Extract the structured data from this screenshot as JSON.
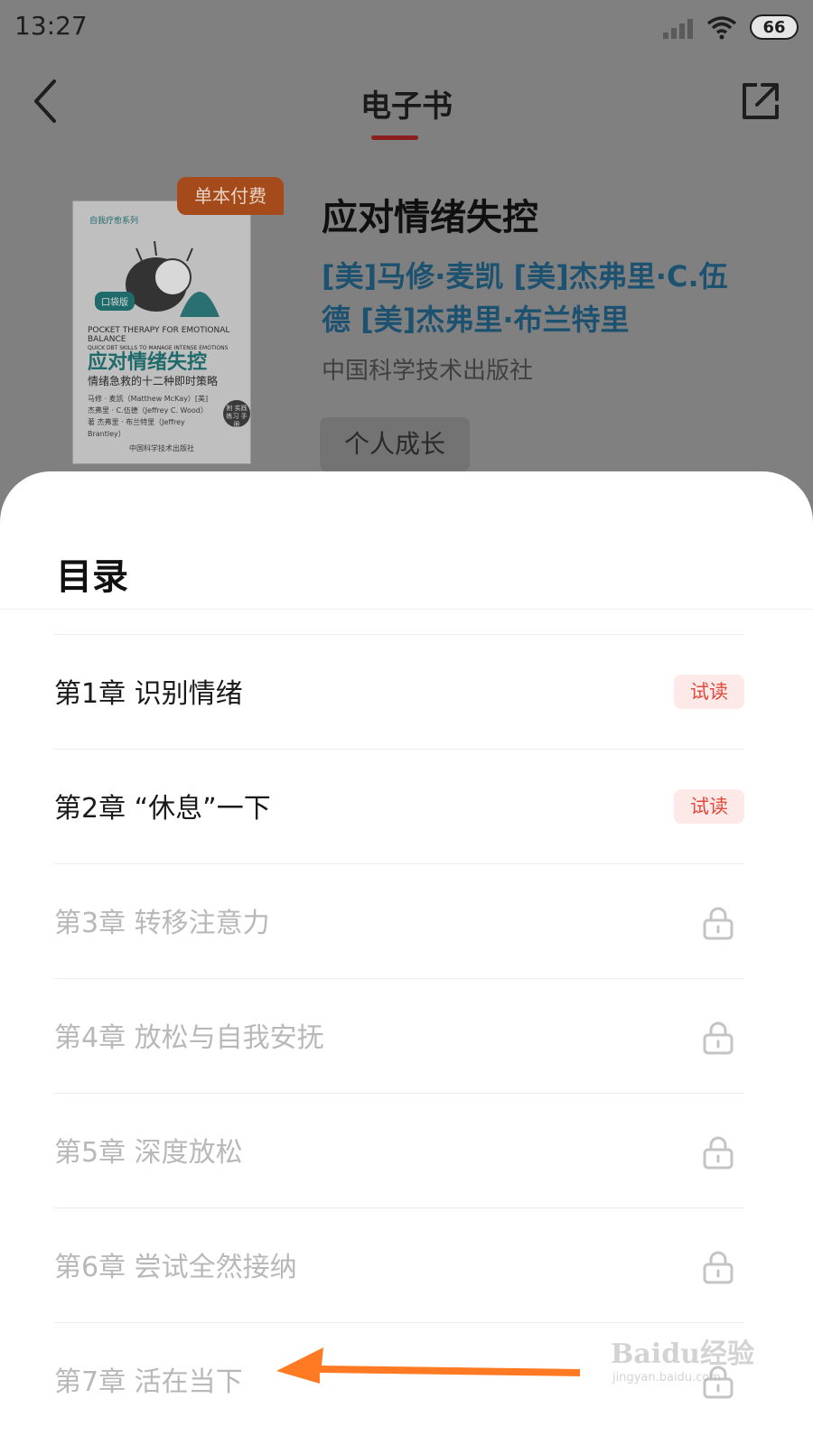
{
  "status_bar": {
    "time": "13:27",
    "battery": "66"
  },
  "nav": {
    "title": "电子书"
  },
  "book": {
    "pay_badge": "单本付费",
    "title": "应对情绪失控",
    "authors": "[美]马修·麦凯 [美]杰弗里·C.伍德 [美]杰弗里·布兰特里",
    "publisher": "中国科学技术出版社",
    "tag": "个人成长",
    "cover": {
      "series": "自我疗愈系列",
      "badge": "口袋版",
      "english_title": "POCKET THERAPY FOR EMOTIONAL BALANCE",
      "english_subtitle": "QUICK DBT SKILLS TO MANAGE INTENSE EMOTIONS",
      "title": "应对情绪失控",
      "subtitle": "情绪急救的十二种即时策略",
      "authors": "马修 · 麦凯（Matthew McKay）[美] 杰弗里 · C.伍德（Jeffrey C. Wood）著 杰弗里 · 布兰特里（Jeffrey Brantley）",
      "stamp": "附 实践练习 手册",
      "publisher": "中国科学技术出版社"
    }
  },
  "toc": {
    "title": "目录",
    "trial_label": "试读",
    "chapters": [
      {
        "label": "第1章 识别情绪",
        "status": "trial"
      },
      {
        "label": "第2章 “休息”一下",
        "status": "trial"
      },
      {
        "label": "第3章 转移注意力",
        "status": "locked"
      },
      {
        "label": "第4章 放松与自我安抚",
        "status": "locked"
      },
      {
        "label": "第5章 深度放松",
        "status": "locked"
      },
      {
        "label": "第6章 尝试全然接纳",
        "status": "locked"
      },
      {
        "label": "第7章 活在当下",
        "status": "locked"
      }
    ]
  },
  "watermark": {
    "logo": "Baidu经验",
    "url": "jingyan.baidu.com"
  },
  "colors": {
    "accent": "#e04a3c",
    "arrow": "#ff7a22",
    "author_link": "#2a7ab0"
  }
}
